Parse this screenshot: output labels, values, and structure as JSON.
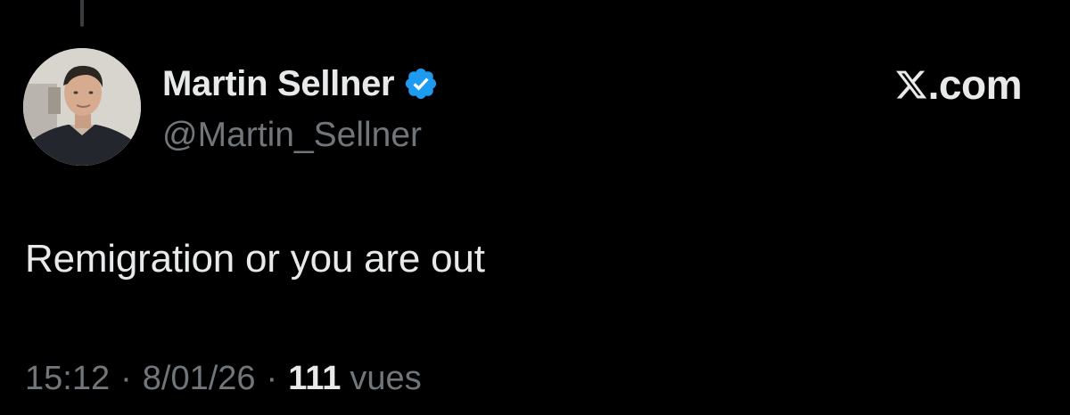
{
  "tweet": {
    "author": {
      "display_name": "Martin Sellner",
      "handle": "@Martin_Sellner",
      "verified": true
    },
    "brand": {
      "logo": "x-logo-icon",
      "text": ".com"
    },
    "text": "Remigration or you are out",
    "meta": {
      "time": "15:12",
      "separator": "·",
      "date": "8/01/26",
      "views_count": "111",
      "views_label": "vues"
    }
  },
  "colors": {
    "background": "#000000",
    "primary_text": "#e7e9ea",
    "secondary_text": "#71767b",
    "verified_badge": "#1d9bf0"
  }
}
